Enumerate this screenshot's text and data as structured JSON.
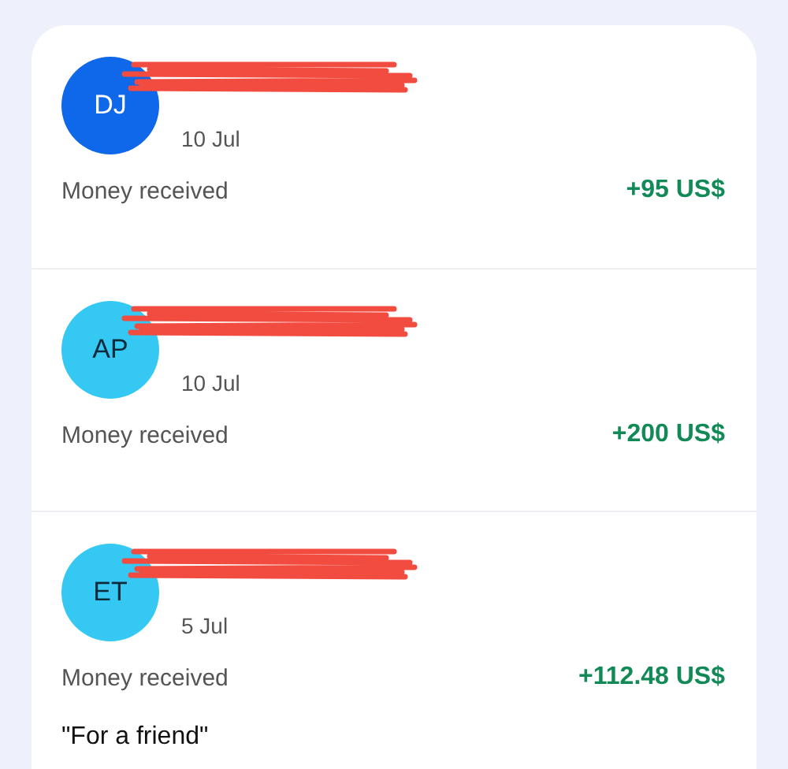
{
  "transactions": [
    {
      "initials": "DJ",
      "color": "#0f67ea",
      "name_redacted": true,
      "date": "10 Jul",
      "type": "Money received",
      "amount": "+95 US$"
    },
    {
      "initials": "AP",
      "color": "#35c8f3",
      "name_redacted": true,
      "date": "10 Jul",
      "type": "Money received",
      "amount": "+200 US$"
    },
    {
      "initials": "ET",
      "color": "#35c8f3",
      "name_redacted": true,
      "date": "5 Jul",
      "type": "Money received",
      "amount": "+112.48 US$",
      "note": "\"For a friend\""
    }
  ]
}
